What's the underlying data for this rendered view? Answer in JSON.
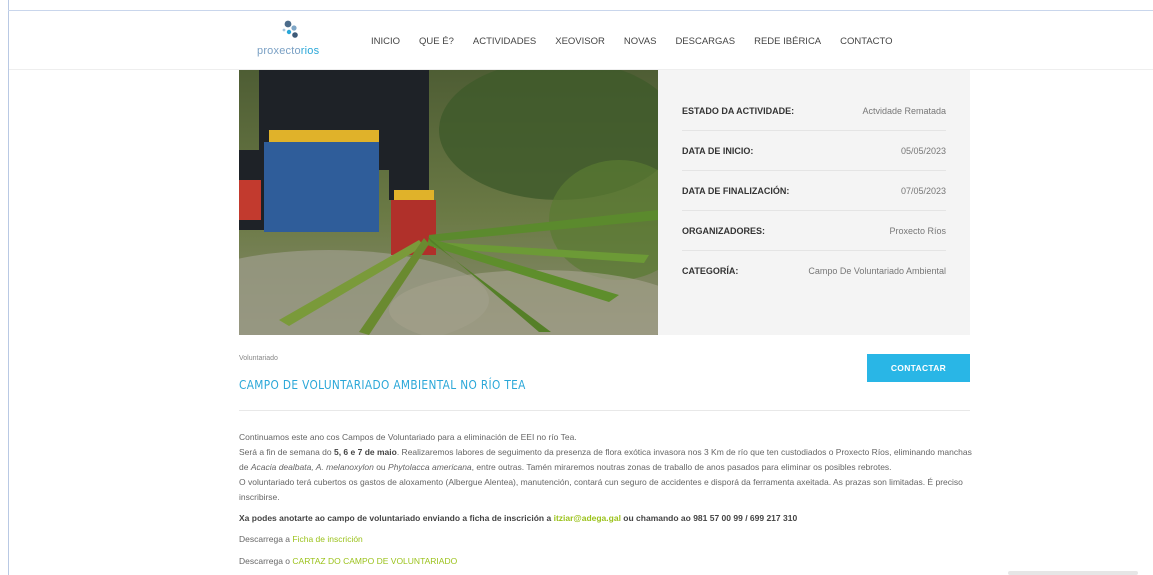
{
  "header": {
    "logo_prefix": "proxecto",
    "logo_suffix": "rios",
    "nav": [
      "INICIO",
      "QUE É?",
      "ACTIVIDADES",
      "XEOVISOR",
      "NOVAS",
      "DESCARGAS",
      "REDE IBÉRICA",
      "CONTACTO"
    ]
  },
  "info": {
    "rows": [
      {
        "label": "ESTADO DA ACTIVIDADE:",
        "value": "Actvidade Rematada"
      },
      {
        "label": "DATA DE INICIO:",
        "value": "05/05/2023"
      },
      {
        "label": "DATA DE FINALIZACIÓN:",
        "value": "07/05/2023"
      },
      {
        "label": "ORGANIZADORES:",
        "value": "Proxecto Ríos"
      },
      {
        "label": "CATEGORÍA:",
        "value": "Campo De Voluntariado Ambiental"
      }
    ]
  },
  "event": {
    "category": "Voluntariado",
    "title": "CAMPO DE VOLUNTARIADO AMBIENTAL NO RÍO TEA",
    "contact_label": "CONTACTAR"
  },
  "body": {
    "p1": "Continuamos este ano cos Campos de Voluntariado para a eliminación de EEI no río Tea.",
    "p2_a": "Será a fin de semana do ",
    "p2_b": "5, 6 e 7 de maio",
    "p2_c": ". Realizaremos labores de seguimento da presenza de flora exótica invasora nos 3 Km de río que ten custodiados o Proxecto Ríos, eliminando manchas de ",
    "p2_d": "Acacia dealbata, A. melanoxylon",
    "p2_e": " ou ",
    "p2_f": "Phytolacca americana",
    "p2_g": ", entre outras. Tamén miraremos noutras zonas de traballo de anos pasados para eliminar os posibles rebrotes.",
    "p3": "O voluntariado terá cubertos os gastos de aloxamento (Albergue Alentea), manutención, contará cun seguro de accidentes e disporá da ferramenta axeitada. As prazas son limitadas. É preciso inscribirse.",
    "p4_a": "Xa podes anotarte ao campo de voluntariado enviando a ficha de inscrición a ",
    "p4_email": "itziar@adega.gal",
    "p4_b": " ou chamando ao 981 57 00 99 / 699 217 310",
    "p5_a": "Descarrega a ",
    "p5_link": "Ficha de inscrición",
    "p6_a": "Descarrega o ",
    "p6_link": "CARTAZ DO CAMPO DE VOLUNTARIADO"
  },
  "colors": {
    "accent": "#2aa7d8",
    "button": "#29b6e6",
    "link": "#9bc21b"
  }
}
